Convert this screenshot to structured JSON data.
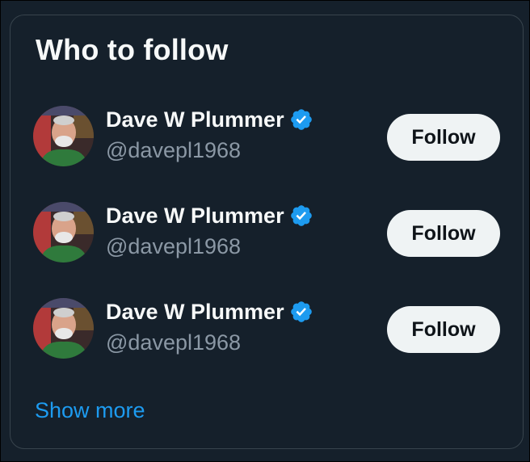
{
  "widget": {
    "title": "Who to follow",
    "show_more_label": "Show more"
  },
  "suggestions": [
    {
      "name": "Dave W Plummer",
      "handle": "@davepl1968",
      "verified": true,
      "follow_label": "Follow",
      "avatar_icon": "user-avatar-photo"
    },
    {
      "name": "Dave W Plummer",
      "handle": "@davepl1968",
      "verified": true,
      "follow_label": "Follow",
      "avatar_icon": "user-avatar-photo"
    },
    {
      "name": "Dave W Plummer",
      "handle": "@davepl1968",
      "verified": true,
      "follow_label": "Follow",
      "avatar_icon": "user-avatar-photo"
    }
  ],
  "colors": {
    "background": "#15202b",
    "border": "#38444d",
    "text_primary": "#f7f9f9",
    "text_secondary": "#8b98a5",
    "accent": "#1d9bf0",
    "button_bg": "#eff3f4",
    "button_text": "#0f1419"
  }
}
